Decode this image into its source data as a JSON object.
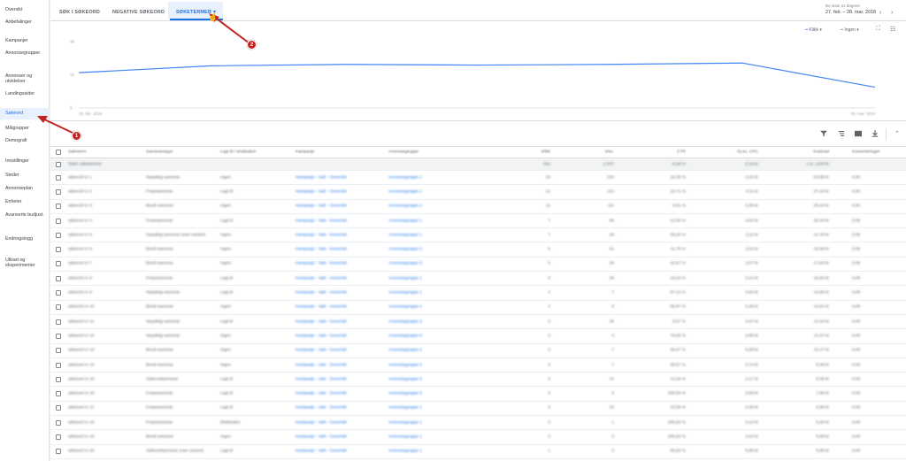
{
  "sidebar": {
    "items": [
      {
        "label": "Oversikt"
      },
      {
        "label": "Anbefalinger"
      },
      {
        "label": "Kampanjer"
      },
      {
        "label": "Annonsegrupper"
      },
      {
        "label": "Annonser og utvidelser"
      },
      {
        "label": "Landingssider"
      },
      {
        "label": "Søkeord"
      },
      {
        "label": "Målgrupper"
      },
      {
        "label": "Demografi"
      },
      {
        "label": "Innstillinger"
      },
      {
        "label": "Steder"
      },
      {
        "label": "Annonseplan"
      },
      {
        "label": "Enheter"
      },
      {
        "label": "Avanserte budjust."
      },
      {
        "label": "Endringslogg"
      },
      {
        "label": "Utkast og eksperimenter"
      }
    ]
  },
  "tabs": [
    {
      "label": "SØK I SØKEORD"
    },
    {
      "label": "NEGATIVE SØKEORD"
    },
    {
      "label": "SØKETERMER"
    }
  ],
  "date_range": {
    "label": "De siste 31 dagene",
    "value": "27. feb. – 28. mar. 2018"
  },
  "chart_legend": {
    "metric1": "Klikk",
    "metric2": "Ingen"
  },
  "chart_data": {
    "type": "line",
    "x": [
      "26. feb. 2018",
      "",
      "",
      "",
      "",
      "",
      "28. mar. 2018"
    ],
    "series": [
      {
        "values": [
          25.5,
          30.5,
          31.5,
          31,
          31.5,
          32.5,
          15
        ]
      }
    ],
    "ylim": [
      0,
      48
    ],
    "yticks": [
      "0",
      "24",
      "48"
    ],
    "x_labels": [
      "26. feb. 2018",
      "28. mar. 2018"
    ],
    "color": "#4285f4",
    "grid": false
  },
  "annotations": [
    {
      "label": "1"
    },
    {
      "label": "2"
    }
  ],
  "table": {
    "headers": [
      "Søketerm",
      "Samsvarstype",
      "Lagt til / ekskludert",
      "Kampanje",
      "Annonsegruppe",
      "Klikk",
      "Visn.",
      "CTR",
      "Gj.sn. CPC",
      "Kostnad",
      "Konverteringer"
    ],
    "total_row": [
      "Total: Søketermer",
      "",
      "",
      "",
      "",
      "341",
      "1 527",
      "8,28 %",
      "2,13 kr",
      "1 8...0,00 kr",
      ""
    ],
    "rows": [
      [
        "søkeord nr 1",
        "Nøyaktig samsvar",
        "Ingen",
        "Kampanje - Søk - Generisk",
        "Annonsegruppe 1",
        "16",
        "104",
        "15,38 %",
        "3,42 kr",
        "54,68 kr",
        "0,00"
      ],
      [
        "søkeord nr 2",
        "Frasesamsvar",
        "Lagt til",
        "Kampanje - Søk - Generisk",
        "Annonsegruppe 1",
        "12",
        "112",
        "10,71 %",
        "3,11 kr",
        "37,33 kr",
        "0,00"
      ],
      [
        "søkeord nr 3",
        "Bredt samsvar",
        "Ingen",
        "Kampanje - Søk - Generisk",
        "Annonsegruppe 2",
        "11",
        "111",
        "9,91 %",
        "2,65 kr",
        "29,18 kr",
        "0,00"
      ],
      [
        "søkeord nr 4",
        "Frasesamsvar",
        "Lagt til",
        "Kampanje - Søk - Generisk",
        "Annonsegruppe 1",
        "7",
        "56",
        "12,50 %",
        "3,62 kr",
        "25,34 kr",
        "0,00"
      ],
      [
        "søkeord nr 5",
        "Nøyaktig samsvar (nær variant)",
        "Ingen",
        "Kampanje - Søk - Generisk",
        "Annonsegruppe 1",
        "7",
        "28",
        "25,00 %",
        "3,11 kr",
        "21,78 kr",
        "0,00"
      ],
      [
        "søkeord nr 6",
        "Bredt samsvar",
        "Ingen",
        "Kampanje - Søk - Generisk",
        "Annonsegruppe 2",
        "6",
        "51",
        "11,76 %",
        "3,01 kr",
        "18,06 kr",
        "0,00"
      ],
      [
        "søkeord nr 7",
        "Bredt samsvar",
        "Ingen",
        "Kampanje - Søk - Generisk",
        "Annonsegruppe 3",
        "5",
        "30",
        "16,67 %",
        "3,57 kr",
        "17,83 kr",
        "0,00"
      ],
      [
        "søkeord nr 8",
        "Frasesamsvar",
        "Lagt til",
        "Kampanje - Søk - Generisk",
        "Annonsegruppe 1",
        "5",
        "26",
        "19,23 %",
        "3,12 kr",
        "15,62 kr",
        "0,00"
      ],
      [
        "søkeord nr 9",
        "Nøyaktig samsvar",
        "Lagt til",
        "Kampanje - Søk - Generisk",
        "Annonsegruppe 1",
        "4",
        "7",
        "57,14 %",
        "3,64 kr",
        "14,55 kr",
        "0,00"
      ],
      [
        "søkeord nr 10",
        "Bredt samsvar",
        "Ingen",
        "Kampanje - Søk - Generisk",
        "Annonsegruppe 4",
        "4",
        "6",
        "66,67 %",
        "3,48 kr",
        "13,91 kr",
        "0,00"
      ],
      [
        "søkeord nr 11",
        "Nøyaktig samsvar",
        "Lagt til",
        "Kampanje - Søk - Generisk",
        "Annonsegruppe 3",
        "3",
        "35",
        "8,57 %",
        "4,07 kr",
        "12,20 kr",
        "0,00"
      ],
      [
        "søkeord nr 12",
        "Nøyaktig samsvar",
        "Ingen",
        "Kampanje - Søk - Generisk",
        "Annonsegruppe 5",
        "3",
        "4",
        "75,00 %",
        "3,86 kr",
        "11,57 kr",
        "0,00"
      ],
      [
        "søkeord nr 13",
        "Bredt samsvar",
        "Ingen",
        "Kampanje - Søk - Generisk",
        "Annonsegruppe 2",
        "2",
        "7",
        "28,57 %",
        "5,08 kr",
        "10,17 kr",
        "0,00"
      ],
      [
        "søkeord nr 14",
        "Bredt samsvar",
        "Ingen",
        "Kampanje - Søk - Generisk",
        "Annonsegruppe 2",
        "2",
        "7",
        "28,57 %",
        "4,74 kr",
        "9,48 kr",
        "0,00"
      ],
      [
        "søkeord nr 15",
        "Søkeordsamsvar",
        "Lagt til",
        "Kampanje - Søk - Generisk",
        "Annonsegruppe 3",
        "2",
        "14",
        "14,29 %",
        "4,17 kr",
        "8,35 kr",
        "0,00"
      ],
      [
        "søkeord nr 16",
        "Frasesamsvar",
        "Lagt til",
        "Kampanje - Søk - Generisk",
        "Annonsegruppe 3",
        "2",
        "2",
        "100,00 %",
        "3,83 kr",
        "7,66 kr",
        "0,00"
      ],
      [
        "søkeord nr 17",
        "Frasesamsvar",
        "Lagt til",
        "Kampanje - Søk - Generisk",
        "Annonsegruppe 1",
        "2",
        "20",
        "10,00 %",
        "3,45 kr",
        "6,90 kr",
        "0,00"
      ],
      [
        "søkeord nr 18",
        "Frasesamsvar",
        "Ekskludert",
        "Kampanje - Søk - Generisk",
        "Annonsegruppe 1",
        "2",
        "1",
        "200,00 %",
        "3,13 kr",
        "6,26 kr",
        "0,00"
      ],
      [
        "søkeord nr 19",
        "Bredt samsvar",
        "Ingen",
        "Kampanje - Søk - Generisk",
        "Annonsegruppe 1",
        "2",
        "2",
        "100,00 %",
        "3,04 kr",
        "6,08 kr",
        "0,00"
      ],
      [
        "søkeord nr 20",
        "Søkeordsamsvar (nær variant)",
        "Lagt til",
        "Kampanje - Søk - Generisk",
        "Annonsegruppe 1",
        "1",
        "2",
        "50,00 %",
        "5,98 kr",
        "5,98 kr",
        "0,00"
      ]
    ]
  },
  "colors": {
    "accent": "#1a73e8",
    "line": "#4285f4",
    "annotation": "#c5221f"
  }
}
